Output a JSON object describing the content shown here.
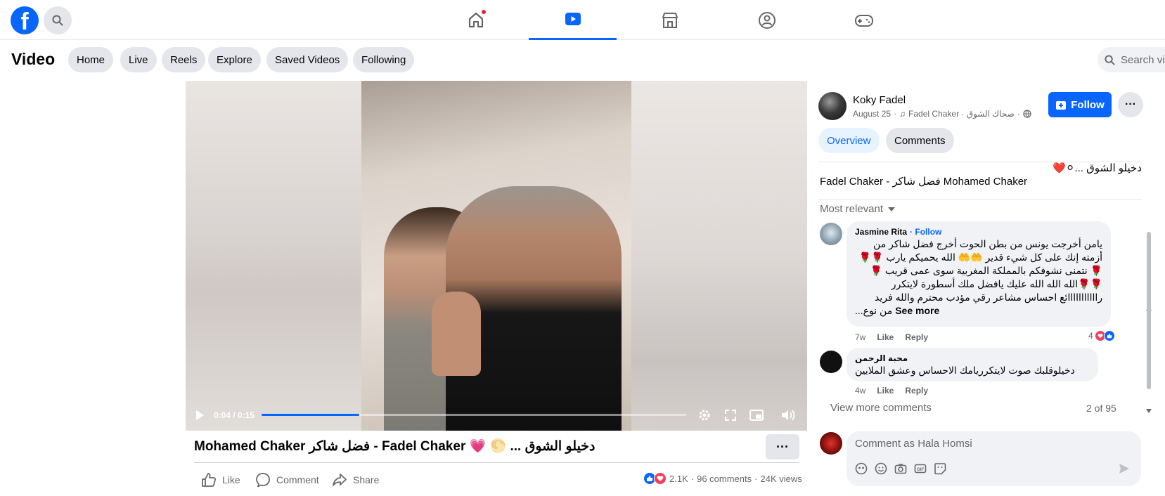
{
  "header": {
    "logo_letter": "f",
    "nav_tabs": [
      {
        "name": "home",
        "active": false,
        "has_notification": true
      },
      {
        "name": "video",
        "active": true,
        "has_notification": false
      },
      {
        "name": "marketplace",
        "active": false,
        "has_notification": false
      },
      {
        "name": "groups",
        "active": false,
        "has_notification": false
      },
      {
        "name": "gaming",
        "active": false,
        "has_notification": false
      }
    ]
  },
  "subnav": {
    "title": "Video",
    "pills": [
      "Home",
      "Live",
      "Reels",
      "Explore",
      "Saved Videos",
      "Following"
    ],
    "search_placeholder": "Search vid"
  },
  "player": {
    "time": "0:04 / 0:15",
    "progress_fraction": 0.23
  },
  "video_title": "Mohamed Chaker فضل شاكر - Fadel Chaker 💗 🌕 ... دخيلو الشوق",
  "actions": {
    "like": "Like",
    "comment": "Comment",
    "share": "Share"
  },
  "stats": {
    "reactions": "2.1K",
    "comments": "96 comments",
    "views": "24K views",
    "separator": "·"
  },
  "post": {
    "author": "Koky Fadel",
    "date": "August 25",
    "audio": "صحاك الشوق · Fadel Chaker",
    "dot": "·",
    "follow_label": "Follow",
    "tabs": [
      "Overview",
      "Comments"
    ],
    "caption_line1": "دخيلو الشوق ...⚪❤️",
    "caption_line2": "Fadel Chaker - فضل شاكر Mohamed Chaker"
  },
  "comments_section": {
    "sort_label": "Most relevant",
    "comments": [
      {
        "author": "Jasmine Rita",
        "follow": "· Follow",
        "lines": [
          "يامن أخرجت يونس من بطن الحوت أخرج فضل شاكر من",
          "أزمته إنك على كل شيء قدير 🤲🤲 الله يحميكم يارب 🌹🌹",
          "🌹 نتمنى نشوفكم بالمملكة المغربية سوى عمى قريب 🌹",
          "🌹🌹الله الله الله عليك يافضل ملك أسطورة لايتكرر",
          "رااااااااااائع احساس مشاعر رقي مؤدب محترم والله فريد",
          "من نوع..."
        ],
        "see_more": "See more",
        "time": "7w",
        "like": "Like",
        "reply": "Reply",
        "reaction_count": "4"
      },
      {
        "author": "محبة الرحمن",
        "lines": [
          "دخيلوقلبك صوت لايتكرريامك الاحساس وعشق الملايين"
        ],
        "time": "4w",
        "like": "Like",
        "reply": "Reply"
      }
    ],
    "view_more": "View more comments",
    "count": "2 of 95",
    "composer_placeholder": "Comment as Hala Homsi"
  },
  "colors": {
    "accent": "#0866ff",
    "notification": "#e41e3f",
    "secondary_text": "#65676b"
  }
}
